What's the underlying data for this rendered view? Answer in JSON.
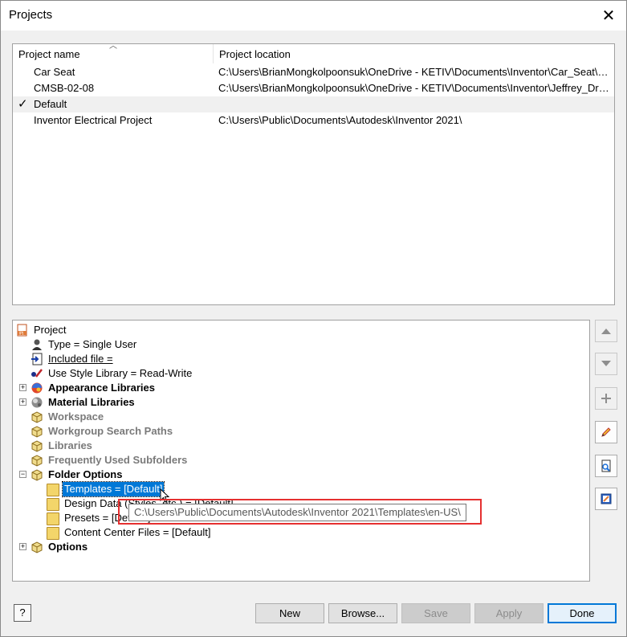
{
  "window": {
    "title": "Projects",
    "close_icon": "close-icon"
  },
  "projects": {
    "columns": [
      "Project name",
      "Project location"
    ],
    "rows": [
      {
        "name": "Car Seat",
        "location": "C:\\Users\\BrianMongkolpoonsuk\\OneDrive - KETIV\\Documents\\Inventor\\Car_Seat\\C...",
        "active": false
      },
      {
        "name": "CMSB-02-08",
        "location": "C:\\Users\\BrianMongkolpoonsuk\\OneDrive - KETIV\\Documents\\Inventor\\Jeffrey_Dra...",
        "active": false
      },
      {
        "name": "Default",
        "location": "",
        "active": true,
        "check": "✓"
      },
      {
        "name": "Inventor Electrical Project",
        "location": "C:\\Users\\Public\\Documents\\Autodesk\\Inventor 2021\\",
        "active": false
      }
    ]
  },
  "tree": {
    "root": "Project",
    "type": "Type = Single User",
    "included_file": "Included file =",
    "style_library": "Use Style Library = Read-Write",
    "appearance_libraries": "Appearance Libraries",
    "material_libraries": "Material Libraries",
    "workspace": "Workspace",
    "workgroup_paths": "Workgroup Search Paths",
    "libraries": "Libraries",
    "frequent_subfolders": "Frequently Used Subfolders",
    "folder_options": "Folder Options",
    "templates": "Templates = [Default]",
    "design_data": "Design Data (Styles, etc.) = [Default]",
    "presets": "Presets = [Default]",
    "content_center": "Content Center Files = [Default]",
    "options": "Options"
  },
  "tooltip": {
    "text": "C:\\Users\\Public\\Documents\\Autodesk\\Inventor 2021\\Templates\\en-US\\"
  },
  "buttons": {
    "help": "?",
    "new": "New",
    "browse": "Browse...",
    "save": "Save",
    "apply": "Apply",
    "done": "Done"
  },
  "colors": {
    "selection": "#0078d7",
    "highlight_box": "#e53030",
    "default_button": "#0078d7"
  }
}
